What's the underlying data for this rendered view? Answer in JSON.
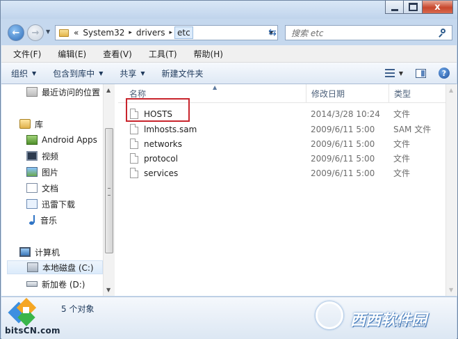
{
  "window": {
    "caption_buttons": {
      "minimize": "minimize",
      "maximize": "maximize",
      "close_glyph": "x"
    }
  },
  "address_bar": {
    "overflow": "«",
    "segments": [
      "System32",
      "drivers",
      "etc"
    ],
    "separator": "▸"
  },
  "search": {
    "placeholder": "搜索 etc"
  },
  "menu": [
    "文件(F)",
    "编辑(E)",
    "查看(V)",
    "工具(T)",
    "帮助(H)"
  ],
  "toolbar": {
    "organize": "组织",
    "include_in_library": "包含到库中",
    "share": "共享",
    "new_folder": "新建文件夹"
  },
  "nav": {
    "recent": "最近访问的位置",
    "libraries": "库",
    "library_items": [
      "Android Apps",
      "视频",
      "图片",
      "文档",
      "迅雷下载",
      "音乐"
    ],
    "computer": "计算机",
    "drives": [
      "本地磁盘 (C:)",
      "新加卷 (D:)"
    ],
    "selected": "本地磁盘 (C:)"
  },
  "columns": {
    "name": "名称",
    "date": "修改日期",
    "type": "类型"
  },
  "files": [
    {
      "name": "HOSTS",
      "date": "2014/3/28 10:24",
      "type": "文件"
    },
    {
      "name": "lmhosts.sam",
      "date": "2009/6/11 5:00",
      "type": "SAM 文件"
    },
    {
      "name": "networks",
      "date": "2009/6/11 5:00",
      "type": "文件"
    },
    {
      "name": "protocol",
      "date": "2009/6/11 5:00",
      "type": "文件"
    },
    {
      "name": "services",
      "date": "2009/6/11 5:00",
      "type": "文件"
    }
  ],
  "status": {
    "count_text": "5 个对象"
  },
  "watermarks": {
    "left": "bitsCN.com",
    "right": "西西软件园",
    "right_sub": "CR173.COM"
  },
  "colors": {
    "highlight_box": "#c8242c",
    "accent": "#1e395b"
  }
}
